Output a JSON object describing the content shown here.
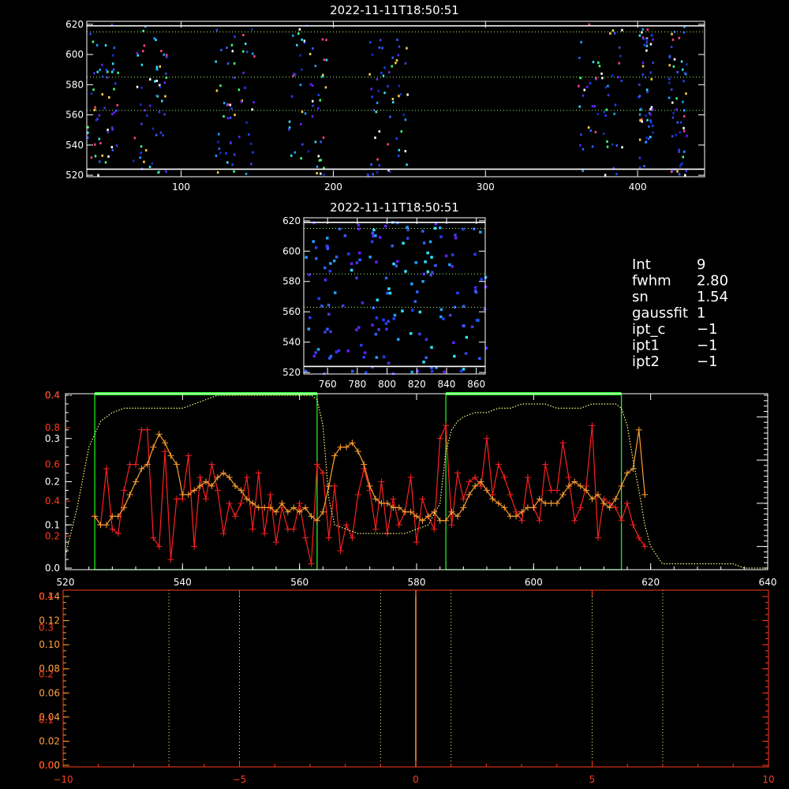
{
  "colors": {
    "background": "#000000",
    "frame_white": "#ffffff",
    "frame_red": "#ff3a1a",
    "orange": "#ffa030",
    "green": "#22ee22",
    "bright_green": "#33ff33",
    "dotted_green": "#a8ff70",
    "dotted_yellow": "#ffff80"
  },
  "info_panel": {
    "lines": [
      {
        "key": "Int",
        "value": "9"
      },
      {
        "key": "fwhm",
        "value": "2.80"
      },
      {
        "key": "sn",
        "value": "1.54"
      },
      {
        "key": "gaussfit",
        "value": "1"
      },
      {
        "key": "ipt_c",
        "value": "−1"
      },
      {
        "key": "ipt1",
        "value": "−1"
      },
      {
        "key": "ipt2",
        "value": "−1"
      }
    ]
  },
  "chart_data": [
    {
      "id": "top_image",
      "type": "heatmap",
      "title": "2022-11-11T18:50:51",
      "xlim": [
        38,
        444
      ],
      "ylim": [
        519,
        622
      ],
      "x_ticks": [
        100,
        200,
        300,
        400
      ],
      "y_ticks": [
        520,
        540,
        560,
        580,
        600,
        620
      ],
      "hlines_solid": [
        524,
        619
      ],
      "hlines_dotted": [
        563,
        585,
        615
      ],
      "bright_bands": [
        [
          38,
          58
        ],
        [
          68,
          90
        ],
        [
          122,
          148
        ],
        [
          170,
          195
        ],
        [
          222,
          250
        ],
        [
          360,
          390
        ],
        [
          400,
          410
        ],
        [
          420,
          432
        ]
      ]
    },
    {
      "id": "mid_image",
      "type": "heatmap",
      "title": "2022-11-11T18:50:51",
      "xlim": [
        744,
        866
      ],
      "ylim": [
        519,
        622
      ],
      "x_ticks": [
        760,
        780,
        800,
        820,
        840,
        860
      ],
      "y_ticks": [
        520,
        540,
        560,
        580,
        600,
        620
      ],
      "hlines_solid": [
        524,
        619
      ],
      "hlines_dotted": [
        563,
        585,
        615
      ]
    },
    {
      "id": "profile",
      "type": "line",
      "xlim": [
        520,
        640
      ],
      "x_ticks": [
        520,
        540,
        560,
        580,
        600,
        620,
        640
      ],
      "left_axis_white": {
        "ylim": [
          0,
          0.4
        ],
        "ticks": [
          0.0,
          0.1,
          0.2,
          0.3,
          0.4
        ]
      },
      "left_axis_red_labels": [
        {
          "label": "0.2",
          "value": 0.074
        },
        {
          "label": "0.4",
          "value": 0.155
        },
        {
          "label": "0.6",
          "value": 0.24
        },
        {
          "label": "0.8",
          "value": 0.325
        },
        {
          "label": "0.4",
          "value": 0.4
        }
      ],
      "green_boxes": [
        [
          525,
          563
        ],
        [
          585,
          615
        ]
      ],
      "series": [
        {
          "color": "red",
          "x": [
            525,
            526,
            527,
            528,
            529,
            530,
            531,
            532,
            533,
            534,
            535,
            536,
            537,
            538,
            539,
            540,
            541,
            542,
            543,
            544,
            545,
            546,
            547,
            548,
            549,
            550,
            551,
            552,
            553,
            554,
            555,
            556,
            557,
            558,
            559,
            560,
            561,
            562,
            563,
            564,
            565,
            566,
            567,
            568,
            569,
            570,
            571,
            572,
            573,
            574,
            575,
            576,
            577,
            578,
            579,
            580,
            581,
            582,
            583,
            584,
            585,
            586,
            587,
            588,
            589,
            590,
            591,
            592,
            593,
            594,
            595,
            596,
            597,
            598,
            599,
            600,
            601,
            602,
            603,
            604,
            605,
            606,
            607,
            608,
            609,
            610,
            611,
            612,
            613,
            614,
            615,
            616,
            617,
            618,
            619
          ],
          "y": [
            0.12,
            0.1,
            0.23,
            0.09,
            0.08,
            0.18,
            0.24,
            0.24,
            0.32,
            0.32,
            0.07,
            0.05,
            0.27,
            0.02,
            0.16,
            0.16,
            0.26,
            0.05,
            0.21,
            0.16,
            0.24,
            0.18,
            0.08,
            0.15,
            0.12,
            0.15,
            0.21,
            0.09,
            0.22,
            0.08,
            0.17,
            0.06,
            0.14,
            0.09,
            0.09,
            0.15,
            0.07,
            0.01,
            0.24,
            0.22,
            0.07,
            0.19,
            0.04,
            0.1,
            0.07,
            0.17,
            0.23,
            0.18,
            0.09,
            0.2,
            0.08,
            0.16,
            0.1,
            0.13,
            0.21,
            0.06,
            0.16,
            0.12,
            0.09,
            0.3,
            0.33,
            0.1,
            0.22,
            0.16,
            0.2,
            0.21,
            0.19,
            0.3,
            0.17,
            0.24,
            0.21,
            0.17,
            0.13,
            0.11,
            0.21,
            0.14,
            0.11,
            0.24,
            0.18,
            0.18,
            0.29,
            0.21,
            0.11,
            0.14,
            0.19,
            0.33,
            0.07,
            0.16,
            0.15,
            0.14,
            0.11,
            0.15,
            0.1,
            0.07,
            0.05
          ]
        },
        {
          "color": "orange",
          "x": [
            525,
            526,
            527,
            528,
            529,
            530,
            531,
            532,
            533,
            534,
            535,
            536,
            537,
            538,
            539,
            540,
            541,
            542,
            543,
            544,
            545,
            546,
            547,
            548,
            549,
            550,
            551,
            552,
            553,
            554,
            555,
            556,
            557,
            558,
            559,
            560,
            561,
            562,
            563,
            564,
            565,
            566,
            567,
            568,
            569,
            570,
            571,
            572,
            573,
            574,
            575,
            576,
            577,
            578,
            579,
            580,
            581,
            582,
            583,
            584,
            585,
            586,
            587,
            588,
            589,
            590,
            591,
            592,
            593,
            594,
            595,
            596,
            597,
            598,
            599,
            600,
            601,
            602,
            603,
            604,
            605,
            606,
            607,
            608,
            609,
            610,
            611,
            612,
            613,
            614,
            615,
            616,
            617,
            618,
            619
          ],
          "y": [
            0.12,
            0.1,
            0.1,
            0.12,
            0.12,
            0.14,
            0.17,
            0.2,
            0.23,
            0.24,
            0.28,
            0.31,
            0.29,
            0.26,
            0.24,
            0.17,
            0.17,
            0.18,
            0.19,
            0.2,
            0.19,
            0.21,
            0.22,
            0.21,
            0.19,
            0.18,
            0.16,
            0.15,
            0.14,
            0.14,
            0.14,
            0.13,
            0.15,
            0.13,
            0.14,
            0.13,
            0.14,
            0.12,
            0.11,
            0.13,
            0.19,
            0.26,
            0.28,
            0.28,
            0.29,
            0.27,
            0.24,
            0.19,
            0.16,
            0.15,
            0.15,
            0.14,
            0.14,
            0.13,
            0.13,
            0.12,
            0.11,
            0.12,
            0.13,
            0.11,
            0.11,
            0.13,
            0.12,
            0.14,
            0.17,
            0.19,
            0.2,
            0.18,
            0.16,
            0.15,
            0.14,
            0.12,
            0.12,
            0.13,
            0.14,
            0.14,
            0.16,
            0.15,
            0.15,
            0.15,
            0.17,
            0.19,
            0.2,
            0.19,
            0.18,
            0.16,
            0.17,
            0.15,
            0.14,
            0.16,
            0.19,
            0.22,
            0.23,
            0.32,
            0.17
          ]
        },
        {
          "color": "dotted_green",
          "x": [
            520,
            522,
            524,
            526,
            528,
            530,
            532,
            534,
            536,
            538,
            540,
            542,
            544,
            546,
            548,
            550,
            552,
            554,
            556,
            558,
            560,
            562,
            563,
            564,
            565,
            566,
            568,
            570,
            572,
            574,
            576,
            578,
            580,
            582,
            584,
            585,
            586,
            587,
            588,
            590,
            592,
            594,
            596,
            598,
            600,
            602,
            604,
            606,
            608,
            610,
            612,
            614,
            615,
            616,
            617,
            618,
            619,
            620,
            621,
            622,
            624,
            626,
            628,
            630,
            632,
            634,
            636,
            638,
            640
          ],
          "y": [
            0.03,
            0.14,
            0.28,
            0.34,
            0.36,
            0.37,
            0.37,
            0.37,
            0.37,
            0.37,
            0.37,
            0.38,
            0.39,
            0.4,
            0.4,
            0.4,
            0.4,
            0.4,
            0.4,
            0.4,
            0.4,
            0.4,
            0.39,
            0.33,
            0.16,
            0.1,
            0.09,
            0.08,
            0.08,
            0.08,
            0.08,
            0.08,
            0.09,
            0.1,
            0.15,
            0.27,
            0.32,
            0.34,
            0.35,
            0.36,
            0.36,
            0.37,
            0.37,
            0.38,
            0.38,
            0.38,
            0.37,
            0.37,
            0.37,
            0.38,
            0.38,
            0.38,
            0.37,
            0.33,
            0.25,
            0.18,
            0.1,
            0.05,
            0.03,
            0.01,
            0.01,
            0.01,
            0.01,
            0.01,
            0.01,
            0.01,
            0.0,
            0.0,
            0.0
          ]
        }
      ]
    },
    {
      "id": "lower",
      "type": "line",
      "xlim": [
        -10,
        10
      ],
      "x_ticks": [
        -10,
        -5,
        0,
        5,
        10
      ],
      "left_axis_orange": {
        "ylim": [
          0,
          0.14
        ],
        "ticks": [
          0.0,
          0.02,
          0.04,
          0.06,
          0.08,
          0.1,
          0.12,
          0.14
        ]
      },
      "left_axis_red_labels": [
        {
          "label": "0.0",
          "value": 0.0
        },
        {
          "label": "0.1",
          "value": 0.0375
        },
        {
          "label": "0.2",
          "value": 0.0755
        },
        {
          "label": "0.3",
          "value": 0.114
        },
        {
          "label": "0.4",
          "value": 0.14
        }
      ],
      "vlines_dotted": [
        -7,
        -5,
        -1,
        1,
        5,
        7
      ],
      "vline_solid_orange": 0
    }
  ]
}
